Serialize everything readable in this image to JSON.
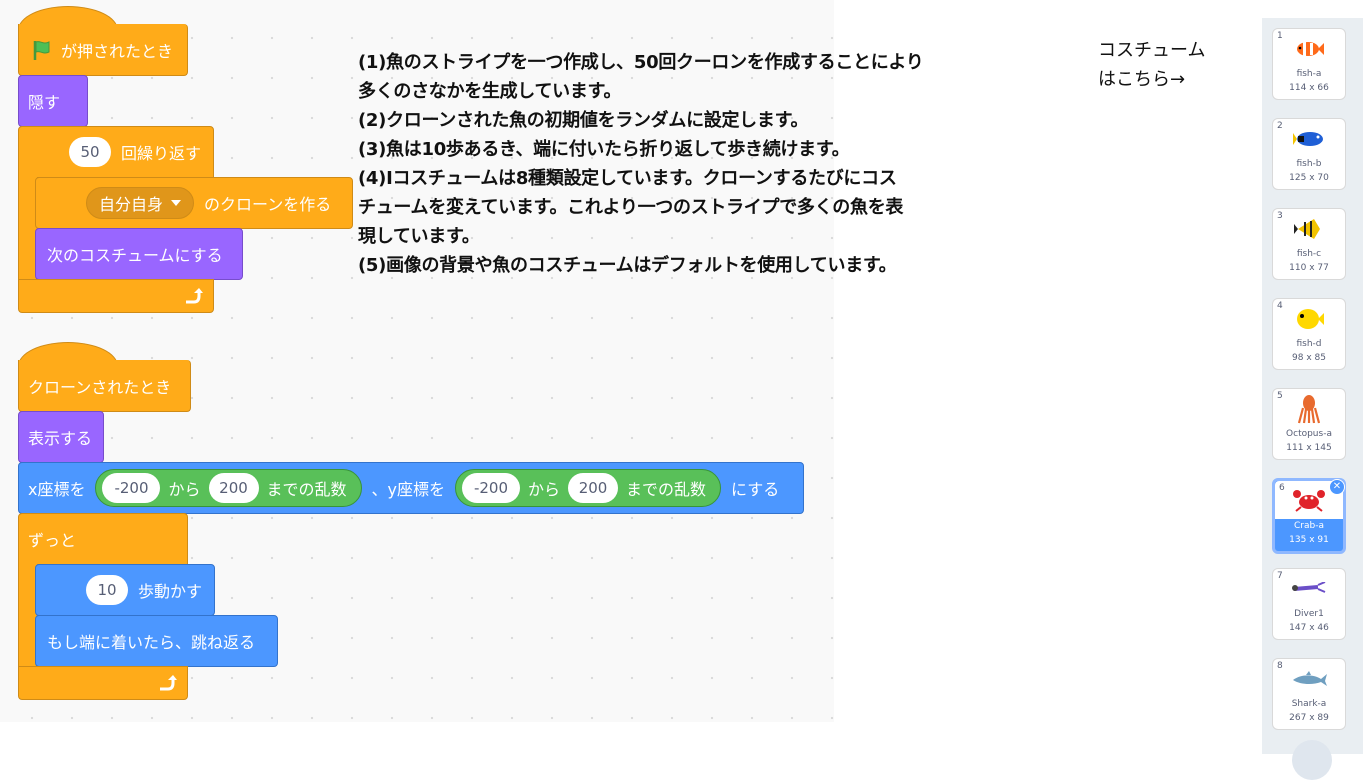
{
  "script1": {
    "hat_label": "が押されたとき",
    "hide": "隠す",
    "repeat_count": "50",
    "repeat_label": "回繰り返す",
    "clone_target": "自分自身",
    "clone_label": "のクローンを作る",
    "next_costume": "次のコスチュームにする"
  },
  "script2": {
    "hat_label": "クローンされたとき",
    "show": "表示する",
    "x_prefix": "x座標を",
    "x_from": "-200",
    "from_word": "から",
    "x_to": "200",
    "random_suffix": "までの乱数",
    "y_prefix": "、y座標を",
    "y_from": "-200",
    "y_to": "200",
    "set_suffix": "にする",
    "forever": "ずっと",
    "steps": "10",
    "move_label": "歩動かす",
    "bounce": "もし端に着いたら、跳ね返る"
  },
  "notes": [
    "(1)魚のストライプを一つ作成し、50回クーロンを作成することにより",
    "多くのさなかを生成しています。",
    "(2)クローンされた魚の初期値をランダムに設定します。",
    "(3)魚は10歩あるき、端に付いたら折り返して歩き続けます。",
    "(4)Iコスチュームは8種類設定しています。クローンするたびにコス",
    "チュームを変えています。これより一つのストライプで多くの魚を表",
    "現しています。",
    "(5)画像の背景や魚のコスチュームはデフォルトを使用しています。"
  ],
  "costume_hint": [
    "コスチューム",
    "はこちら→"
  ],
  "costumes": [
    {
      "num": "1",
      "name": "fish-a",
      "size": "114 x 66",
      "icon": "clownfish-icon",
      "color": "#ff6a1a"
    },
    {
      "num": "2",
      "name": "fish-b",
      "size": "125 x 70",
      "icon": "blue-fish-icon",
      "color": "#1f5fd6"
    },
    {
      "num": "3",
      "name": "fish-c",
      "size": "110 x 77",
      "icon": "angelfish-icon",
      "color": "#f2c300"
    },
    {
      "num": "4",
      "name": "fish-d",
      "size": "98 x 85",
      "icon": "yellow-fish-icon",
      "color": "#ffd800"
    },
    {
      "num": "5",
      "name": "Octopus-a",
      "size": "111 x 145",
      "icon": "octopus-icon",
      "color": "#e86a2e"
    },
    {
      "num": "6",
      "name": "Crab-a",
      "size": "135 x 91",
      "icon": "crab-icon",
      "color": "#e0232a"
    },
    {
      "num": "7",
      "name": "Diver1",
      "size": "147 x 46",
      "icon": "diver-icon",
      "color": "#6b4fc8"
    },
    {
      "num": "8",
      "name": "Shark-a",
      "size": "267 x 89",
      "icon": "shark-icon",
      "color": "#6f9fc0"
    }
  ],
  "selected_costume": "6"
}
